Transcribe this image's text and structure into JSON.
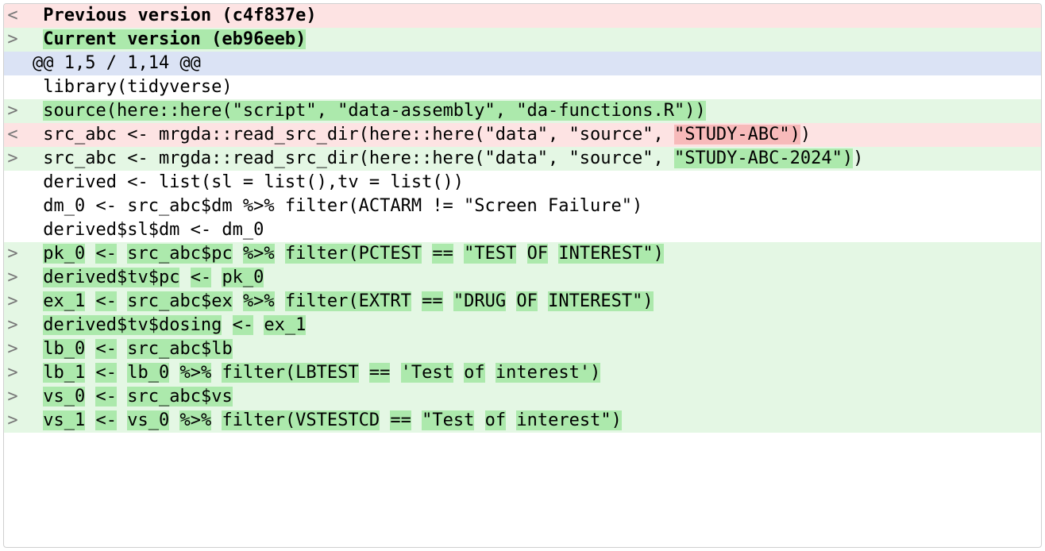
{
  "previous_version_label": "Previous version (c4f837e)",
  "current_version_label": "Current version (eb96eeb)",
  "hunk_header": "@@ 1,5 / 1,14 @@",
  "rows": [
    {
      "marker": "<",
      "gutter_bg": "bg-red",
      "line_bg": "bg-red",
      "bold": true,
      "segments": [
        {
          "t": " ",
          "hl": ""
        },
        {
          "t": "Previous version (c4f837e)",
          "hl": ""
        }
      ]
    },
    {
      "marker": ">",
      "gutter_bg": "bg-green",
      "line_bg": "bg-green",
      "bold": true,
      "segments": [
        {
          "t": " ",
          "hl": ""
        },
        {
          "t": "Current version (eb96eeb)",
          "hl": "hl-green"
        }
      ]
    },
    {
      "marker": "",
      "gutter_bg": "bg-blue",
      "line_bg": "bg-blue",
      "bold": false,
      "segments": [
        {
          "t": "@@ 1,5 / 1,14 @@",
          "hl": ""
        }
      ]
    },
    {
      "marker": "",
      "gutter_bg": "bg-white",
      "line_bg": "bg-white",
      "bold": false,
      "segments": [
        {
          "t": " library(tidyverse)",
          "hl": ""
        }
      ]
    },
    {
      "marker": ">",
      "gutter_bg": "bg-green",
      "line_bg": "bg-green",
      "bold": false,
      "segments": [
        {
          "t": " ",
          "hl": ""
        },
        {
          "t": "source(here::here(\"script\", \"data-assembly\", \"da-functions.R\"))",
          "hl": "hl-green"
        }
      ]
    },
    {
      "marker": "<",
      "gutter_bg": "bg-red",
      "line_bg": "bg-red",
      "bold": false,
      "segments": [
        {
          "t": " src_abc <- mrgda::read_src_dir(here::here(\"data\", \"source\", ",
          "hl": ""
        },
        {
          "t": "\"STUDY-ABC\")",
          "hl": "hl-red"
        },
        {
          "t": ")",
          "hl": ""
        }
      ]
    },
    {
      "marker": ">",
      "gutter_bg": "bg-green",
      "line_bg": "bg-green",
      "bold": false,
      "segments": [
        {
          "t": " src_abc <- mrgda::read_src_dir(here::here(\"data\", \"source\", ",
          "hl": ""
        },
        {
          "t": "\"STUDY-ABC-2024\")",
          "hl": "hl-green"
        },
        {
          "t": ")",
          "hl": ""
        }
      ]
    },
    {
      "marker": "",
      "gutter_bg": "bg-white",
      "line_bg": "bg-white",
      "bold": false,
      "segments": [
        {
          "t": " derived <- list(sl = list(),tv = list())",
          "hl": ""
        }
      ]
    },
    {
      "marker": "",
      "gutter_bg": "bg-white",
      "line_bg": "bg-white",
      "bold": false,
      "segments": [
        {
          "t": " dm_0 <- src_abc$dm %>% filter(ACTARM != \"Screen Failure\")",
          "hl": ""
        }
      ]
    },
    {
      "marker": "",
      "gutter_bg": "bg-white",
      "line_bg": "bg-white",
      "bold": false,
      "segments": [
        {
          "t": " derived$sl$dm <- dm_0",
          "hl": ""
        }
      ]
    },
    {
      "marker": ">",
      "gutter_bg": "bg-green",
      "line_bg": "bg-green",
      "bold": false,
      "segments": [
        {
          "t": " ",
          "hl": ""
        },
        {
          "t": "pk_0",
          "hl": "hl-green"
        },
        {
          "t": " ",
          "hl": ""
        },
        {
          "t": "<-",
          "hl": "hl-green"
        },
        {
          "t": " ",
          "hl": ""
        },
        {
          "t": "src_abc$pc",
          "hl": "hl-green"
        },
        {
          "t": " ",
          "hl": ""
        },
        {
          "t": "%>%",
          "hl": "hl-green"
        },
        {
          "t": " ",
          "hl": ""
        },
        {
          "t": "filter(PCTEST",
          "hl": "hl-green"
        },
        {
          "t": " ",
          "hl": ""
        },
        {
          "t": "==",
          "hl": "hl-green"
        },
        {
          "t": " ",
          "hl": ""
        },
        {
          "t": "\"TEST",
          "hl": "hl-green"
        },
        {
          "t": " ",
          "hl": ""
        },
        {
          "t": "OF",
          "hl": "hl-green"
        },
        {
          "t": " ",
          "hl": ""
        },
        {
          "t": "INTEREST\")",
          "hl": "hl-green"
        }
      ]
    },
    {
      "marker": ">",
      "gutter_bg": "bg-green",
      "line_bg": "bg-green",
      "bold": false,
      "segments": [
        {
          "t": " ",
          "hl": ""
        },
        {
          "t": "derived$tv$pc",
          "hl": "hl-green"
        },
        {
          "t": " ",
          "hl": ""
        },
        {
          "t": "<-",
          "hl": "hl-green"
        },
        {
          "t": " ",
          "hl": ""
        },
        {
          "t": "pk_0",
          "hl": "hl-green"
        }
      ]
    },
    {
      "marker": ">",
      "gutter_bg": "bg-green",
      "line_bg": "bg-green",
      "bold": false,
      "segments": [
        {
          "t": " ",
          "hl": ""
        },
        {
          "t": "ex_1",
          "hl": "hl-green"
        },
        {
          "t": " ",
          "hl": ""
        },
        {
          "t": "<-",
          "hl": "hl-green"
        },
        {
          "t": " ",
          "hl": ""
        },
        {
          "t": "src_abc$ex",
          "hl": "hl-green"
        },
        {
          "t": " ",
          "hl": ""
        },
        {
          "t": "%>%",
          "hl": "hl-green"
        },
        {
          "t": " ",
          "hl": ""
        },
        {
          "t": "filter(EXTRT",
          "hl": "hl-green"
        },
        {
          "t": " ",
          "hl": ""
        },
        {
          "t": "==",
          "hl": "hl-green"
        },
        {
          "t": " ",
          "hl": ""
        },
        {
          "t": "\"DRUG",
          "hl": "hl-green"
        },
        {
          "t": " ",
          "hl": ""
        },
        {
          "t": "OF",
          "hl": "hl-green"
        },
        {
          "t": " ",
          "hl": ""
        },
        {
          "t": "INTEREST\")",
          "hl": "hl-green"
        }
      ]
    },
    {
      "marker": ">",
      "gutter_bg": "bg-green",
      "line_bg": "bg-green",
      "bold": false,
      "segments": [
        {
          "t": " ",
          "hl": ""
        },
        {
          "t": "derived$tv$dosing",
          "hl": "hl-green"
        },
        {
          "t": " ",
          "hl": ""
        },
        {
          "t": "<-",
          "hl": "hl-green"
        },
        {
          "t": " ",
          "hl": ""
        },
        {
          "t": "ex_1",
          "hl": "hl-green"
        }
      ]
    },
    {
      "marker": ">",
      "gutter_bg": "bg-green",
      "line_bg": "bg-green",
      "bold": false,
      "segments": [
        {
          "t": " ",
          "hl": ""
        },
        {
          "t": "lb_0",
          "hl": "hl-green"
        },
        {
          "t": " ",
          "hl": ""
        },
        {
          "t": "<-",
          "hl": "hl-green"
        },
        {
          "t": " ",
          "hl": ""
        },
        {
          "t": "src_abc$lb",
          "hl": "hl-green"
        }
      ]
    },
    {
      "marker": ">",
      "gutter_bg": "bg-green",
      "line_bg": "bg-green",
      "bold": false,
      "segments": [
        {
          "t": " ",
          "hl": ""
        },
        {
          "t": "lb_1",
          "hl": "hl-green"
        },
        {
          "t": " ",
          "hl": ""
        },
        {
          "t": "<-",
          "hl": "hl-green"
        },
        {
          "t": " ",
          "hl": ""
        },
        {
          "t": "lb_0",
          "hl": "hl-green"
        },
        {
          "t": " ",
          "hl": ""
        },
        {
          "t": "%>%",
          "hl": "hl-green"
        },
        {
          "t": " ",
          "hl": ""
        },
        {
          "t": "filter(LBTEST",
          "hl": "hl-green"
        },
        {
          "t": " ",
          "hl": ""
        },
        {
          "t": "==",
          "hl": "hl-green"
        },
        {
          "t": " ",
          "hl": ""
        },
        {
          "t": "'Test",
          "hl": "hl-green"
        },
        {
          "t": " ",
          "hl": ""
        },
        {
          "t": "of",
          "hl": "hl-green"
        },
        {
          "t": " ",
          "hl": ""
        },
        {
          "t": "interest')",
          "hl": "hl-green"
        }
      ]
    },
    {
      "marker": ">",
      "gutter_bg": "bg-green",
      "line_bg": "bg-green",
      "bold": false,
      "segments": [
        {
          "t": " ",
          "hl": ""
        },
        {
          "t": "vs_0",
          "hl": "hl-green"
        },
        {
          "t": " ",
          "hl": ""
        },
        {
          "t": "<-",
          "hl": "hl-green"
        },
        {
          "t": " ",
          "hl": ""
        },
        {
          "t": "src_abc$vs",
          "hl": "hl-green"
        }
      ]
    },
    {
      "marker": ">",
      "gutter_bg": "bg-green",
      "line_bg": "bg-green",
      "bold": false,
      "segments": [
        {
          "t": " ",
          "hl": ""
        },
        {
          "t": "vs_1",
          "hl": "hl-green"
        },
        {
          "t": " ",
          "hl": ""
        },
        {
          "t": "<-",
          "hl": "hl-green"
        },
        {
          "t": " ",
          "hl": ""
        },
        {
          "t": "vs_0",
          "hl": "hl-green"
        },
        {
          "t": " ",
          "hl": ""
        },
        {
          "t": "%>%",
          "hl": "hl-green"
        },
        {
          "t": " ",
          "hl": ""
        },
        {
          "t": "filter(VSTESTCD",
          "hl": "hl-green"
        },
        {
          "t": " ",
          "hl": ""
        },
        {
          "t": "==",
          "hl": "hl-green"
        },
        {
          "t": " ",
          "hl": ""
        },
        {
          "t": "\"Test",
          "hl": "hl-green"
        },
        {
          "t": " ",
          "hl": ""
        },
        {
          "t": "of",
          "hl": "hl-green"
        },
        {
          "t": " ",
          "hl": ""
        },
        {
          "t": "interest\")",
          "hl": "hl-green"
        }
      ]
    }
  ]
}
